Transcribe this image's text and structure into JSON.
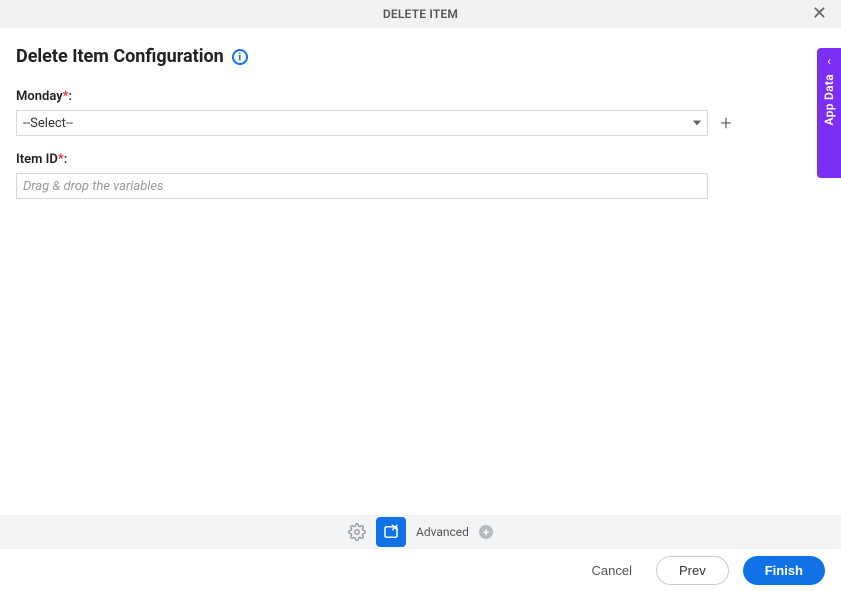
{
  "header": {
    "title": "DELETE ITEM"
  },
  "page": {
    "title": "Delete Item Configuration"
  },
  "fields": {
    "monday": {
      "label": "Monday",
      "required_marker": "*",
      "colon": ":",
      "selected": "--Select--"
    },
    "itemId": {
      "label": "Item ID",
      "required_marker": "*",
      "colon": ":",
      "placeholder": "Drag & drop the variables",
      "value": ""
    }
  },
  "toolbar": {
    "advanced_label": "Advanced"
  },
  "footer": {
    "cancel": "Cancel",
    "prev": "Prev",
    "finish": "Finish"
  },
  "sidetab": {
    "label": "App Data"
  },
  "colors": {
    "primary": "#1072e6",
    "accent": "#7b2ff2"
  }
}
